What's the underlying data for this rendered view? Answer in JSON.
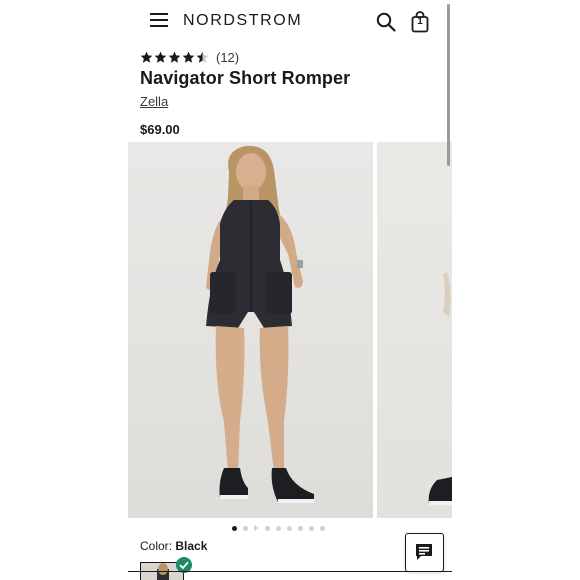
{
  "header": {
    "brand_logo": "NORDSTROM",
    "icons": [
      "menu-icon",
      "search-icon",
      "shopping-bag-icon"
    ],
    "bag_count": "1"
  },
  "product": {
    "rating": 4.5,
    "rating_max": 5,
    "review_count": "(12)",
    "name": "Navigator Short Romper",
    "brand": "Zella",
    "price": "$69.00"
  },
  "gallery": {
    "active_index": 0,
    "total_items": 9
  },
  "color": {
    "label": "Color:",
    "selected": "Black"
  },
  "colors": {
    "text": "#191a1b",
    "selected_check": "#1e8a63",
    "romper": "#2b2d33"
  }
}
